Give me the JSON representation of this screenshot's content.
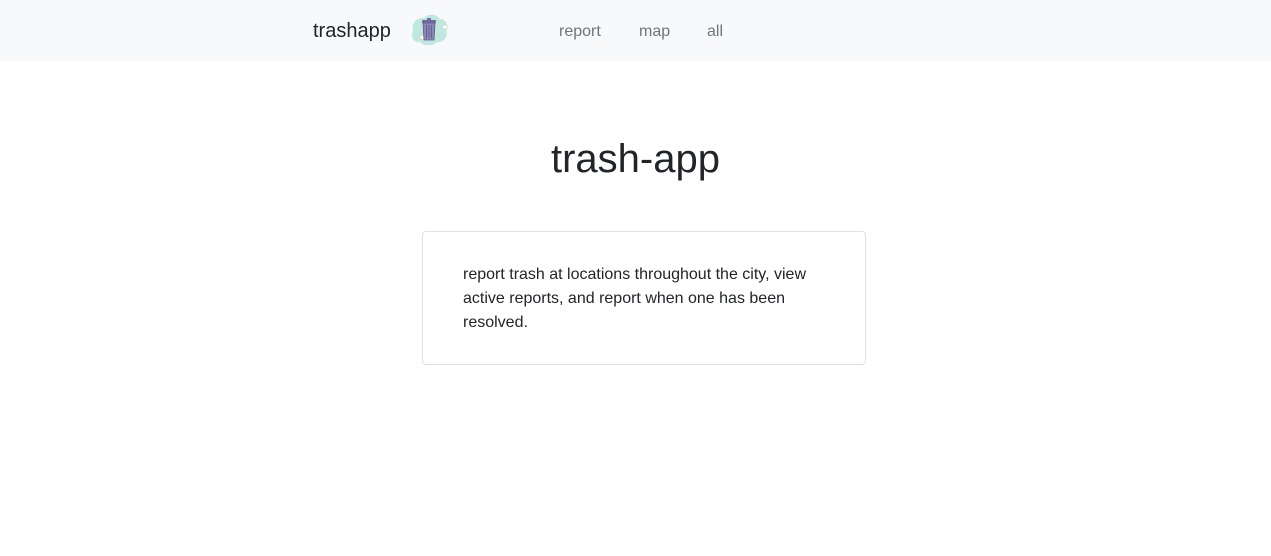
{
  "navbar": {
    "brand": "trashapp",
    "logo_icon": "trash-can-icon",
    "links": [
      "report",
      "map",
      "all"
    ]
  },
  "main": {
    "title": "trash-app",
    "description": "report trash at locations throughout the city, view active reports, and report when one has been resolved."
  },
  "colors": {
    "navbar_bg": "#f8f9fa",
    "text": "#212529",
    "nav_link": "#6c757d",
    "card_border": "#dee2e6",
    "logo_blob": "#bfe9df",
    "logo_can": "#8b86b5"
  }
}
